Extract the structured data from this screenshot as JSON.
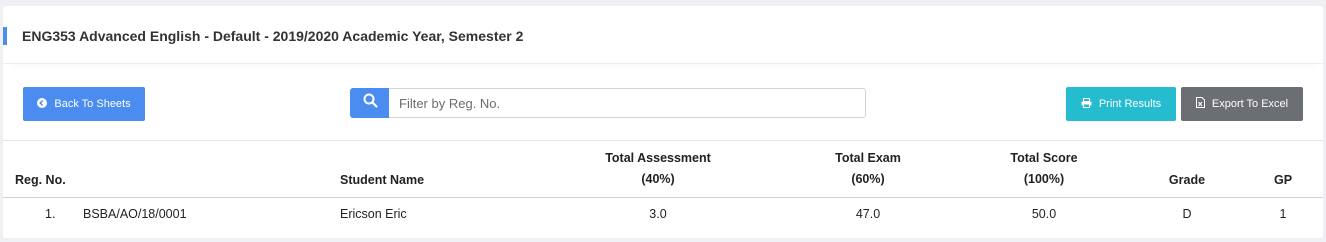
{
  "page": {
    "title": "ENG353 Advanced English - Default - 2019/2020 Academic Year, Semester 2"
  },
  "toolbar": {
    "back_label": "Back To Sheets",
    "search_placeholder": "Filter by Reg. No.",
    "search_value": "",
    "print_label": "Print Results",
    "export_label": "Export To Excel"
  },
  "colors": {
    "primary": "#4a8cf0",
    "info": "#26bccf",
    "secondary": "#6b6f74"
  },
  "icons": {
    "back": "arrow-circle-left-icon",
    "search": "search-icon",
    "print": "printer-icon",
    "export": "file-excel-icon"
  },
  "table": {
    "headers": {
      "reg_no": "Reg. No.",
      "student_name": "Student Name",
      "total_assessment": "Total Assessment",
      "total_assessment_pct": "(40%)",
      "total_exam": "Total Exam",
      "total_exam_pct": "(60%)",
      "total_score": "Total Score",
      "total_score_pct": "(100%)",
      "grade": "Grade",
      "gp": "GP"
    },
    "rows": [
      {
        "index": "1.",
        "reg_no": "BSBA/AO/18/0001",
        "student_name": "Ericson Eric",
        "total_assessment": "3.0",
        "total_exam": "47.0",
        "total_score": "50.0",
        "grade": "D",
        "gp": "1"
      }
    ]
  }
}
